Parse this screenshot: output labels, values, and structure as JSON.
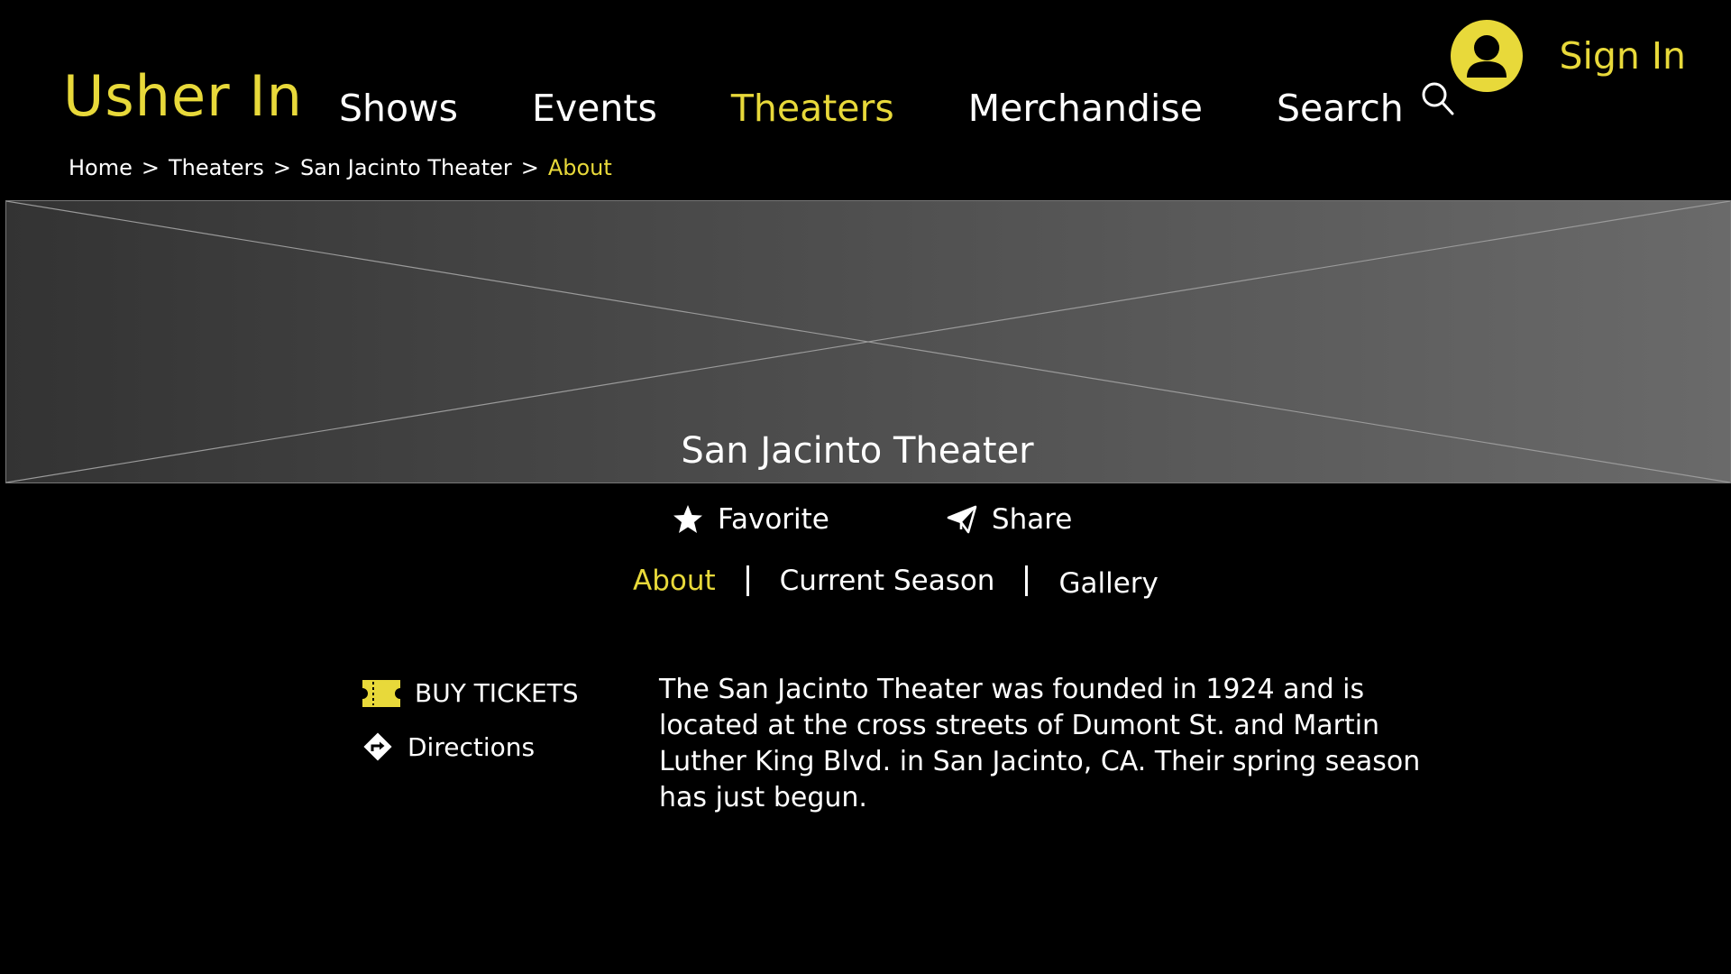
{
  "header": {
    "logo": "Usher In",
    "nav": [
      {
        "label": "Shows",
        "active": false
      },
      {
        "label": "Events",
        "active": false
      },
      {
        "label": "Theaters",
        "active": true
      },
      {
        "label": "Merchandise",
        "active": false
      },
      {
        "label": "Search",
        "active": false
      }
    ],
    "search_icon": "search-icon",
    "sign_in": "Sign In",
    "avatar_icon": "user-avatar-icon"
  },
  "breadcrumb": {
    "items": [
      "Home",
      "Theaters",
      "San Jacinto Theater",
      "About"
    ],
    "separator": ">"
  },
  "hero": {
    "title": "San Jacinto Theater",
    "image_placeholder": "image-placeholder"
  },
  "actions": {
    "favorite": "Favorite",
    "favorite_icon": "star-icon",
    "share": "Share",
    "share_icon": "paper-plane-icon"
  },
  "tabs": [
    {
      "label": "About",
      "active": true
    },
    {
      "label": "Current Season",
      "active": false
    },
    {
      "label": "Gallery",
      "active": false
    }
  ],
  "sidebar": {
    "buy_tickets": "BUY TICKETS",
    "buy_tickets_icon": "ticket-icon",
    "directions": "Directions",
    "directions_icon": "directions-icon"
  },
  "about": {
    "text": "The San Jacinto Theater was founded in 1924 and is located at the cross streets of Dumont St. and Martin Luther King Blvd. in San Jacinto, CA. Their spring season has just begun."
  },
  "colors": {
    "accent": "#e8d93a",
    "background": "#000000",
    "text": "#ffffff"
  }
}
